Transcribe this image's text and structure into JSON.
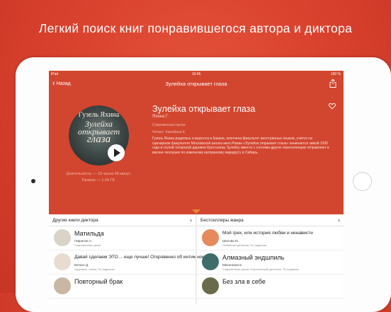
{
  "promo": {
    "headline": "Легкий поиск книг понравившегося автора и диктора"
  },
  "status_bar": {
    "device": "iPad",
    "time": "10:45",
    "battery": "100 %"
  },
  "nav": {
    "back_label": "Назад",
    "title": "Зулейха открывает глаза"
  },
  "cover": {
    "author_text": "Гузель Яхина",
    "title_line1": "Зулейха",
    "title_line2": "открывает",
    "title_line3": "глаза"
  },
  "book": {
    "title": "Зулейха открывает глаза",
    "author": "Яхина Г.",
    "genre": "Современная проза",
    "reader": "Читает: Калабина Е.",
    "description": "Гузель Яхина родилась и выросла в Казани, окончила факультет иностранных языков, учится на сценарном факультете Московской школы кино.Роман «Зулейха открывает глаза» начинается зимой 1930 года в глухой татарской деревне.Крестьянку Зулейху вместе с сотнями других переселенцев отправляют в вагоне-теплушке по извечному каторжному маршруту в Сибирь.",
    "duration": "Длительность — 13 часов 48 минут",
    "size": "Размер — 1.04 ГБ"
  },
  "sections": {
    "left": {
      "header": "Другие книги диктора",
      "items": [
        {
          "title": "Матильда",
          "author": "Гаврилов А.",
          "genre": "Современная проза",
          "color": "#d9d3c8"
        },
        {
          "title": "Давай сделаем ЭТО… еще лучше! Откровенно об интимном",
          "author": "Бельке Д.",
          "genre": "Здоровье, семья, По подписке",
          "color": "#e7dccd"
        },
        {
          "title": "Повторный брак",
          "author": "",
          "genre": "",
          "color": "#c9b7a3"
        }
      ]
    },
    "right": {
      "header": "Бестселлеры жанра",
      "items": [
        {
          "title": "Мой грех, или история любви и ненависти",
          "author": "Шилова Ю.",
          "genre": "Любовный детектив, По подписке",
          "color": "#e58a5a"
        },
        {
          "title": "Алмазный эндшпиль",
          "author": "Михалкова Е.",
          "genre": "Современная проза, Классический детектив, По подписке",
          "color": "#3f6e6a"
        },
        {
          "title": "Без зла в себе",
          "author": "",
          "genre": "",
          "color": "#6a6b4a"
        }
      ]
    }
  }
}
